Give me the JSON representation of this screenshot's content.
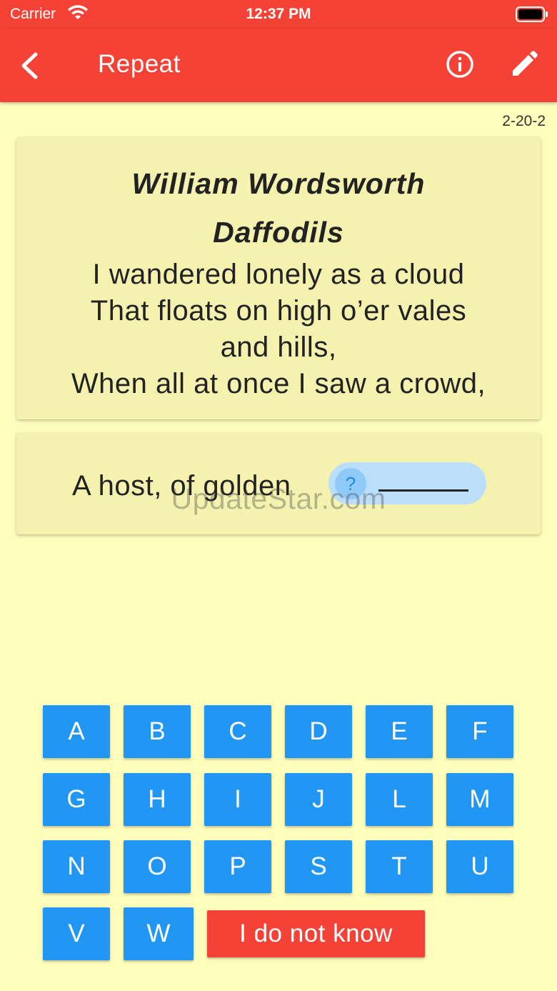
{
  "status_bar": {
    "carrier": "Carrier",
    "time": "12:37 PM"
  },
  "app_bar": {
    "title": "Repeat"
  },
  "code": "2-20-2",
  "poem": {
    "author": "William Wordsworth",
    "title": "Daffodils",
    "lines": [
      "I wandered lonely as a cloud",
      "That floats on high o’er vales",
      "and hills,",
      "When all at once I saw a crowd,"
    ]
  },
  "question": {
    "text": "A host, of golden",
    "answer_hint": "?"
  },
  "watermark": "UpdateStar.com",
  "keyboard": {
    "keys": [
      "A",
      "B",
      "C",
      "D",
      "E",
      "F",
      "G",
      "H",
      "I",
      "J",
      "L",
      "M",
      "N",
      "O",
      "P",
      "S",
      "T",
      "U",
      "V",
      "W"
    ],
    "dont_know": "I do not know"
  },
  "colors": {
    "primary": "#F44336",
    "key": "#2196F3",
    "background": "#FFFDBC",
    "card": "#F5F2B0"
  },
  "icons": {
    "back": "chevron-left-icon",
    "info": "info-icon",
    "edit": "pencil-icon",
    "wifi": "wifi-icon",
    "battery": "battery-icon"
  }
}
